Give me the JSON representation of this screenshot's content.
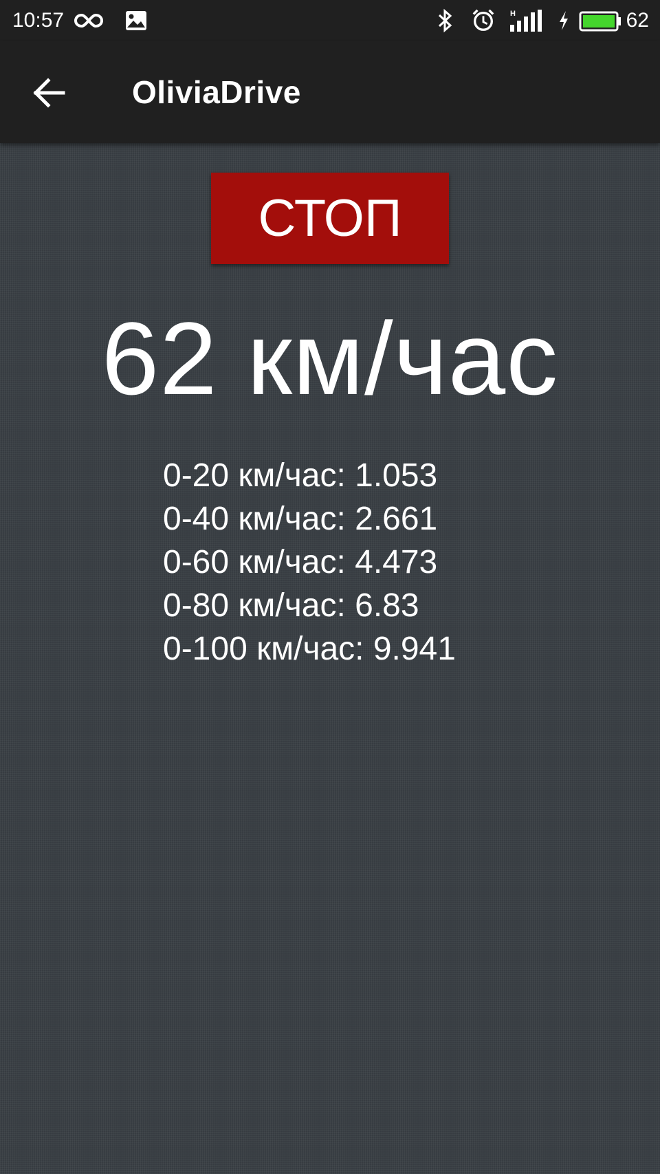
{
  "status_bar": {
    "time": "10:57",
    "battery_level": "62",
    "icons": [
      "infinity-icon",
      "image-notification-icon",
      "bluetooth-icon",
      "alarm-icon",
      "signal-icon",
      "charging-icon",
      "battery-icon"
    ],
    "battery_fill_color": "#44d62c"
  },
  "app_bar": {
    "back_icon": "arrow-left-icon",
    "title": "OliviaDrive"
  },
  "main": {
    "stop_label": "СТОП",
    "stop_color": "#a30e0b",
    "current_speed": "62 км/час",
    "acceleration_results": [
      {
        "label": "0-20 км/час: 1.053"
      },
      {
        "label": "0-40 км/час: 2.661"
      },
      {
        "label": "0-60 км/час: 4.473"
      },
      {
        "label": "0-80 км/час: 6.83"
      },
      {
        "label": "0-100 км/час: 9.941"
      }
    ]
  }
}
